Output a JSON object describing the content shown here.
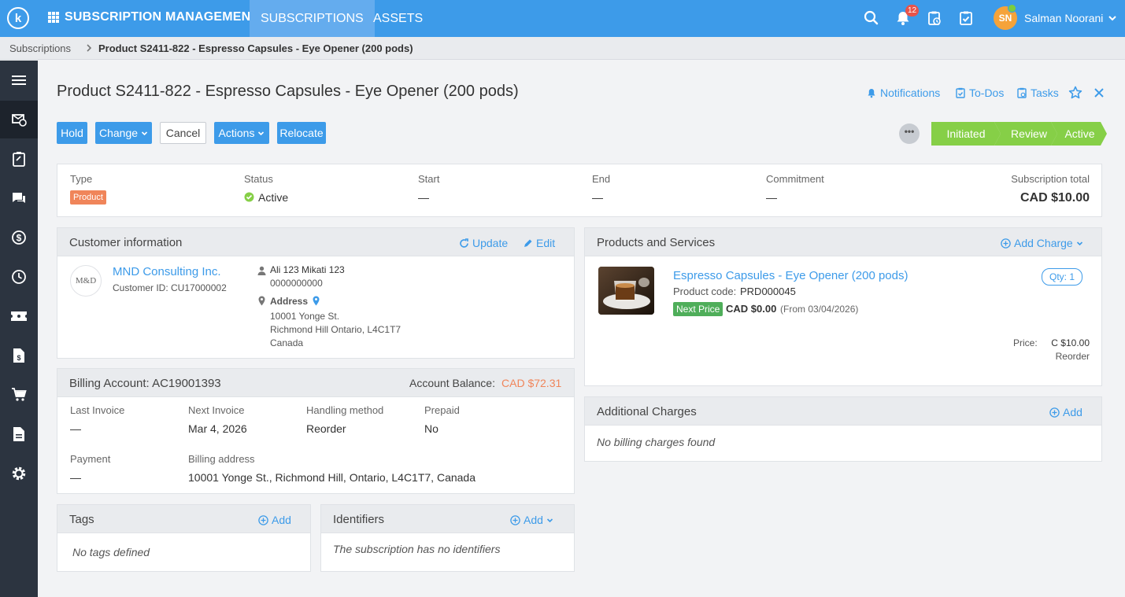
{
  "topbar": {
    "logo": "k",
    "app_title": "SUBSCRIPTION MANAGEMENT",
    "tabs": [
      {
        "label": "SUBSCRIPTIONS"
      },
      {
        "label": "ASSETS"
      }
    ],
    "notification_count": "12",
    "user_initials": "SN",
    "user_name": "Salman Noorani",
    "brand_color": "#3d9be9"
  },
  "breadcrumb": {
    "root": "Subscriptions",
    "current": "Product S2411-822 - Espresso Capsules - Eye Opener (200 pods)"
  },
  "sidebar": {
    "icons": [
      "menu-icon",
      "subscription-icon",
      "clipboard-icon",
      "chat-icon",
      "dollar-icon",
      "clock-icon",
      "ticket-icon",
      "invoice-icon",
      "cart-icon",
      "document-icon",
      "gear-icon"
    ]
  },
  "header": {
    "title": "Product S2411-822 - Espresso Capsules - Eye Opener (200 pods)",
    "links": {
      "notifications": "Notifications",
      "todos": "To-Dos",
      "tasks": "Tasks"
    }
  },
  "toolbar": {
    "hold": "Hold",
    "change": "Change",
    "cancel": "Cancel",
    "actions": "Actions",
    "relocate": "Relocate",
    "more": "•••"
  },
  "stages": [
    "Initiated",
    "Review",
    "Active"
  ],
  "summary": {
    "type_label": "Type",
    "type_value": "Product",
    "status_label": "Status",
    "status_value": "Active",
    "start_label": "Start",
    "start_value": "—",
    "end_label": "End",
    "end_value": "—",
    "commitment_label": "Commitment",
    "commitment_value": "—",
    "total_label": "Subscription total",
    "total_value": "CAD $10.00"
  },
  "customer": {
    "title": "Customer information",
    "update": "Update",
    "edit": "Edit",
    "logo_text": "M&D",
    "name": "MND Consulting Inc.",
    "customer_id": "Customer ID:  CU17000002",
    "contact_name": "Ali 123 Mikati 123",
    "contact_phone": "0000000000",
    "address_label": "Address",
    "address_line1": "10001 Yonge St.",
    "address_line2": "Richmond Hill Ontario, L4C1T7",
    "address_line3": "Canada"
  },
  "billing": {
    "title": "Billing Account: AC19001393",
    "balance_label": "Account Balance:",
    "balance_value": "CAD $72.31",
    "last_invoice_label": "Last Invoice",
    "last_invoice_value": "—",
    "next_invoice_label": "Next Invoice",
    "next_invoice_value": "Mar 4, 2026",
    "handling_label": "Handling method",
    "handling_value": "Reorder",
    "prepaid_label": "Prepaid",
    "prepaid_value": "No",
    "payment_label": "Payment",
    "payment_value": "—",
    "address_label": "Billing address",
    "address_value": "10001 Yonge St., Richmond Hill, Ontario, L4C1T7, Canada"
  },
  "tags": {
    "title": "Tags",
    "add": "Add",
    "empty": "No tags defined"
  },
  "identifiers": {
    "title": "Identifiers",
    "add": "Add",
    "empty": "The subscription has no identifiers"
  },
  "products": {
    "title": "Products and Services",
    "add_charge": "Add Charge",
    "item_name": "Espresso Capsules - Eye Opener (200 pods)",
    "product_code_label": "Product code:",
    "product_code": "PRD000045",
    "next_price_badge": "Next Price",
    "next_price": "CAD $0.00",
    "next_price_from": "(From 03/04/2026)",
    "qty": "Qty: 1",
    "price_label": "Price:",
    "price_value": "C $10.00",
    "price_note": "Reorder"
  },
  "additional": {
    "title": "Additional Charges",
    "add": "Add",
    "empty": "No billing charges found"
  }
}
